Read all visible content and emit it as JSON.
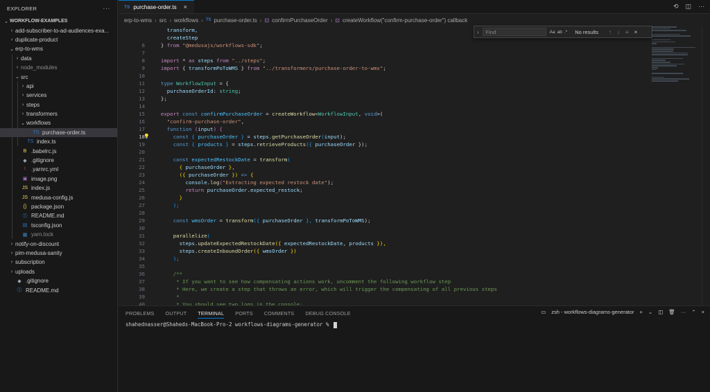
{
  "sidebar": {
    "title": "EXPLORER",
    "more": "···",
    "items": [
      {
        "label": "WORKFLOW-EXAMPLES",
        "indent": 0,
        "chev": "⌄",
        "icon": "",
        "bold": true
      },
      {
        "label": "add-subscriber-to-ad-audiences-exa...",
        "indent": 1,
        "chev": "›",
        "icon": ""
      },
      {
        "label": "duplicate-product",
        "indent": 1,
        "chev": "›",
        "icon": ""
      },
      {
        "label": "erp-to-wms",
        "indent": 1,
        "chev": "⌄",
        "icon": ""
      },
      {
        "label": "data",
        "indent": 2,
        "chev": "›",
        "icon": ""
      },
      {
        "label": "node_modules",
        "indent": 2,
        "chev": "›",
        "icon": "",
        "dim": true
      },
      {
        "label": "src",
        "indent": 2,
        "chev": "⌄",
        "icon": ""
      },
      {
        "label": "api",
        "indent": 3,
        "chev": "›",
        "icon": ""
      },
      {
        "label": "services",
        "indent": 3,
        "chev": "›",
        "icon": ""
      },
      {
        "label": "steps",
        "indent": 3,
        "chev": "›",
        "icon": ""
      },
      {
        "label": "transformers",
        "indent": 3,
        "chev": "›",
        "icon": ""
      },
      {
        "label": "workflows",
        "indent": 3,
        "chev": "⌄",
        "icon": ""
      },
      {
        "label": "purchase-order.ts",
        "indent": 4,
        "chev": "",
        "icon": "TS",
        "iconColor": "#3178c6",
        "selected": true
      },
      {
        "label": "index.ts",
        "indent": 3,
        "chev": "",
        "icon": "TS",
        "iconColor": "#3178c6"
      },
      {
        "label": ".babelrc.js",
        "indent": 2,
        "chev": "",
        "icon": "B",
        "iconColor": "#f5da55"
      },
      {
        "label": ".gitignore",
        "indent": 2,
        "chev": "",
        "icon": "◆",
        "iconColor": "#9da5b4"
      },
      {
        "label": ".yarnrc.yml",
        "indent": 2,
        "chev": "",
        "icon": "!",
        "iconColor": "#cb5a5a"
      },
      {
        "label": "image.png",
        "indent": 2,
        "chev": "",
        "icon": "▣",
        "iconColor": "#a074c4"
      },
      {
        "label": "index.js",
        "indent": 2,
        "chev": "",
        "icon": "JS",
        "iconColor": "#f5da55"
      },
      {
        "label": "medusa-config.js",
        "indent": 2,
        "chev": "",
        "icon": "JS",
        "iconColor": "#f5da55"
      },
      {
        "label": "package.json",
        "indent": 2,
        "chev": "",
        "icon": "{}",
        "iconColor": "#f5da55"
      },
      {
        "label": "README.md",
        "indent": 2,
        "chev": "",
        "icon": "ⓘ",
        "iconColor": "#42a5f5"
      },
      {
        "label": "tsconfig.json",
        "indent": 2,
        "chev": "",
        "icon": "▤",
        "iconColor": "#3178c6"
      },
      {
        "label": "yarn.lock",
        "indent": 2,
        "chev": "",
        "icon": "▦",
        "iconColor": "#3e86c6",
        "dim": true
      },
      {
        "label": "notify-on-discount",
        "indent": 1,
        "chev": "›",
        "icon": ""
      },
      {
        "label": "pim-medusa-sanity",
        "indent": 1,
        "chev": "›",
        "icon": ""
      },
      {
        "label": "subscription",
        "indent": 1,
        "chev": "›",
        "icon": ""
      },
      {
        "label": "uploads",
        "indent": 1,
        "chev": "›",
        "icon": ""
      },
      {
        "label": ".gitignore",
        "indent": 1,
        "chev": "",
        "icon": "◆",
        "iconColor": "#9da5b4"
      },
      {
        "label": "README.md",
        "indent": 1,
        "chev": "",
        "icon": "ⓘ",
        "iconColor": "#42a5f5"
      }
    ]
  },
  "editor": {
    "tab": {
      "icon": "TS",
      "label": "purchase-order.ts",
      "close": "×"
    },
    "breadcrumb": [
      "erp-to-wms",
      "src",
      "workflows",
      "purchase-order.ts",
      "confirmPurchaseOrder",
      "createWorkflow(\"confirm-purchase-order\") callback"
    ],
    "find": {
      "placeholder": "Find",
      "result": "No results",
      "opt_case": "Aa",
      "opt_word": "ab",
      "opt_regex": ".*"
    },
    "code": [
      {
        "n": "",
        "segs": [
          [
            "    transform,",
            "k-var"
          ]
        ]
      },
      {
        "n": "",
        "segs": [
          [
            "    createStep",
            "k-var"
          ]
        ]
      },
      {
        "n": "6",
        "segs": [
          [
            "  } ",
            "k-punc"
          ],
          [
            "from ",
            "k-purp"
          ],
          [
            "\"@medusajs/workflows-sdk\"",
            "k-str"
          ],
          [
            ";",
            "k-punc"
          ]
        ]
      },
      {
        "n": "7",
        "segs": []
      },
      {
        "n": "8",
        "segs": [
          [
            "  import ",
            "k-purp"
          ],
          [
            "* ",
            "k-punc"
          ],
          [
            "as ",
            "k-purp"
          ],
          [
            "steps ",
            "k-var"
          ],
          [
            "from ",
            "k-purp"
          ],
          [
            "\"../steps\"",
            "k-str"
          ],
          [
            ";",
            "k-punc"
          ]
        ]
      },
      {
        "n": "9",
        "segs": [
          [
            "  import ",
            "k-purp"
          ],
          [
            "{ ",
            "k-punc"
          ],
          [
            "transformPoToWMS ",
            "k-var"
          ],
          [
            "} ",
            "k-punc"
          ],
          [
            "from ",
            "k-purp"
          ],
          [
            "\"../transformers/purchase-order-to-wms\"",
            "k-str"
          ],
          [
            ";",
            "k-punc"
          ]
        ]
      },
      {
        "n": "10",
        "segs": []
      },
      {
        "n": "11",
        "segs": [
          [
            "  type ",
            "k-blue"
          ],
          [
            "WorkflowInput ",
            "k-type"
          ],
          [
            "= {",
            "k-punc"
          ]
        ]
      },
      {
        "n": "12",
        "segs": [
          [
            "    purchaseOrderId",
            "k-var"
          ],
          [
            ": ",
            "k-punc"
          ],
          [
            "string",
            "k-type"
          ],
          [
            ";",
            "k-punc"
          ]
        ]
      },
      {
        "n": "13",
        "segs": [
          [
            "  };",
            "k-punc"
          ]
        ]
      },
      {
        "n": "14",
        "segs": []
      },
      {
        "n": "15",
        "segs": [
          [
            "  export ",
            "k-purp"
          ],
          [
            "const ",
            "k-blue"
          ],
          [
            "confirmPurchaseOrder ",
            "k-const"
          ],
          [
            "= ",
            "k-punc"
          ],
          [
            "createWorkflow",
            "k-fn"
          ],
          [
            "<",
            "k-punc"
          ],
          [
            "WorkflowInput",
            "k-type"
          ],
          [
            ", ",
            "k-punc"
          ],
          [
            "void",
            "k-blue"
          ],
          [
            ">(",
            "k-punc"
          ]
        ]
      },
      {
        "n": "16",
        "segs": [
          [
            "    \"confirm-purchase-order\"",
            "k-str"
          ],
          [
            ",",
            "k-punc"
          ]
        ]
      },
      {
        "n": "17",
        "segs": [
          [
            "    function ",
            "k-blue"
          ],
          [
            "(",
            "k-p"
          ],
          [
            "input",
            "k-var"
          ],
          [
            ") ",
            "k-p"
          ],
          [
            "{",
            "k-p"
          ]
        ]
      },
      {
        "n": "18",
        "active": true,
        "bulb": true,
        "segs": [
          [
            "      const ",
            "k-blue"
          ],
          [
            "{ ",
            "k-b"
          ],
          [
            "purchaseOrder ",
            "k-const"
          ],
          [
            "} ",
            "k-b"
          ],
          [
            "= ",
            "k-punc"
          ],
          [
            "steps",
            "k-var"
          ],
          [
            ".",
            "k-punc"
          ],
          [
            "getPurchaseOrder",
            "k-fn"
          ],
          [
            "(",
            "k-b"
          ],
          [
            "input",
            "k-var"
          ],
          [
            ");",
            "k-punc"
          ]
        ]
      },
      {
        "n": "19",
        "segs": [
          [
            "      const ",
            "k-blue"
          ],
          [
            "{ ",
            "k-b"
          ],
          [
            "products ",
            "k-const"
          ],
          [
            "} ",
            "k-b"
          ],
          [
            "= ",
            "k-punc"
          ],
          [
            "steps",
            "k-var"
          ],
          [
            ".",
            "k-punc"
          ],
          [
            "retrieveProducts",
            "k-fn"
          ],
          [
            "({ ",
            "k-b"
          ],
          [
            "purchaseOrder ",
            "k-var"
          ],
          [
            "});",
            "k-punc"
          ]
        ]
      },
      {
        "n": "20",
        "segs": []
      },
      {
        "n": "21",
        "segs": [
          [
            "      const ",
            "k-blue"
          ],
          [
            "expectedRestockDate ",
            "k-const"
          ],
          [
            "= ",
            "k-punc"
          ],
          [
            "transform",
            "k-fn"
          ],
          [
            "(",
            "k-b"
          ]
        ]
      },
      {
        "n": "22",
        "segs": [
          [
            "        { ",
            "k-y"
          ],
          [
            "purchaseOrder ",
            "k-var"
          ],
          [
            "},",
            "k-y"
          ]
        ]
      },
      {
        "n": "23",
        "segs": [
          [
            "        ({ ",
            "k-y"
          ],
          [
            "purchaseOrder ",
            "k-var"
          ],
          [
            "}) ",
            "k-y"
          ],
          [
            "=> ",
            "k-blue"
          ],
          [
            "{",
            "k-y"
          ]
        ]
      },
      {
        "n": "24",
        "segs": [
          [
            "          console",
            "k-var"
          ],
          [
            ".",
            "k-punc"
          ],
          [
            "log",
            "k-fn"
          ],
          [
            "(",
            "k-p"
          ],
          [
            "\"Extracting expected restock date\"",
            "k-str"
          ],
          [
            ");",
            "k-punc"
          ]
        ]
      },
      {
        "n": "25",
        "segs": [
          [
            "          return ",
            "k-purp"
          ],
          [
            "purchaseOrder",
            "k-var"
          ],
          [
            ".",
            "k-punc"
          ],
          [
            "expected_restock",
            "k-var"
          ],
          [
            ";",
            "k-punc"
          ]
        ]
      },
      {
        "n": "26",
        "segs": [
          [
            "        }",
            "k-y"
          ]
        ]
      },
      {
        "n": "27",
        "segs": [
          [
            "      );",
            "k-b"
          ]
        ]
      },
      {
        "n": "28",
        "segs": []
      },
      {
        "n": "29",
        "segs": [
          [
            "      const ",
            "k-blue"
          ],
          [
            "wmsOrder ",
            "k-const"
          ],
          [
            "= ",
            "k-punc"
          ],
          [
            "transform",
            "k-fn"
          ],
          [
            "({ ",
            "k-b"
          ],
          [
            "purchaseOrder ",
            "k-var"
          ],
          [
            "}, ",
            "k-b"
          ],
          [
            "transformPoToWMS",
            "k-var"
          ],
          [
            ");",
            "k-punc"
          ]
        ]
      },
      {
        "n": "30",
        "segs": []
      },
      {
        "n": "31",
        "segs": [
          [
            "      parallelize",
            "k-fn"
          ],
          [
            "(",
            "k-b"
          ]
        ]
      },
      {
        "n": "32",
        "segs": [
          [
            "        steps",
            "k-var"
          ],
          [
            ".",
            "k-punc"
          ],
          [
            "updateExpectedRestockDate",
            "k-fn"
          ],
          [
            "({ ",
            "k-y"
          ],
          [
            "expectedRestockDate",
            "k-var"
          ],
          [
            ", ",
            "k-punc"
          ],
          [
            "products ",
            "k-var"
          ],
          [
            "}),",
            "k-y"
          ]
        ]
      },
      {
        "n": "33",
        "segs": [
          [
            "        steps",
            "k-var"
          ],
          [
            ".",
            "k-punc"
          ],
          [
            "createInboundOrder",
            "k-fn"
          ],
          [
            "({ ",
            "k-y"
          ],
          [
            "wmsOrder ",
            "k-var"
          ],
          [
            "})",
            "k-y"
          ]
        ]
      },
      {
        "n": "34",
        "segs": [
          [
            "      );",
            "k-b"
          ]
        ]
      },
      {
        "n": "35",
        "segs": []
      },
      {
        "n": "36",
        "segs": [
          [
            "      /**",
            "k-com"
          ]
        ]
      },
      {
        "n": "37",
        "segs": [
          [
            "       * If you want to see how compensating actions work, uncomment the following workflow step",
            "k-com"
          ]
        ]
      },
      {
        "n": "38",
        "segs": [
          [
            "       * Here, we create a step that throws an error, which will trigger the compensating of all previous steps",
            "k-com"
          ]
        ]
      },
      {
        "n": "39",
        "segs": [
          [
            "       *",
            "k-com"
          ]
        ]
      },
      {
        "n": "40",
        "segs": [
          [
            "       * You should see two logs in the console:",
            "k-com"
          ]
        ]
      }
    ]
  },
  "panel": {
    "tabs": [
      "PROBLEMS",
      "OUTPUT",
      "TERMINAL",
      "PORTS",
      "COMMENTS",
      "DEBUG CONSOLE"
    ],
    "active": "TERMINAL",
    "terminal_name": "zsh - workflows-diagrams-generator",
    "prompt": "shahednasser@Shaheds-MacBook-Pro-2 workflows-diagrams-generator % "
  }
}
